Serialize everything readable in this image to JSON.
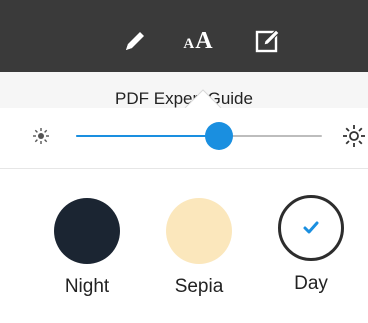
{
  "toolbar": {
    "icons": [
      "pencil-icon",
      "font-size-icon",
      "edit-note-icon"
    ],
    "font_small": "A",
    "font_large": "A"
  },
  "document": {
    "title": "PDF Expert Guide"
  },
  "brightness": {
    "icon_low": "sun-small-icon",
    "icon_high": "sun-large-icon",
    "level": 0.58,
    "accent": "#1a8fe0"
  },
  "themes": {
    "items": [
      {
        "label": "Night",
        "color": "#1b2532",
        "selected": false
      },
      {
        "label": "Sepia",
        "color": "#fbe7bc",
        "selected": false
      },
      {
        "label": "Day",
        "color": "#ffffff",
        "selected": true
      }
    ],
    "check_icon": "check-icon"
  }
}
